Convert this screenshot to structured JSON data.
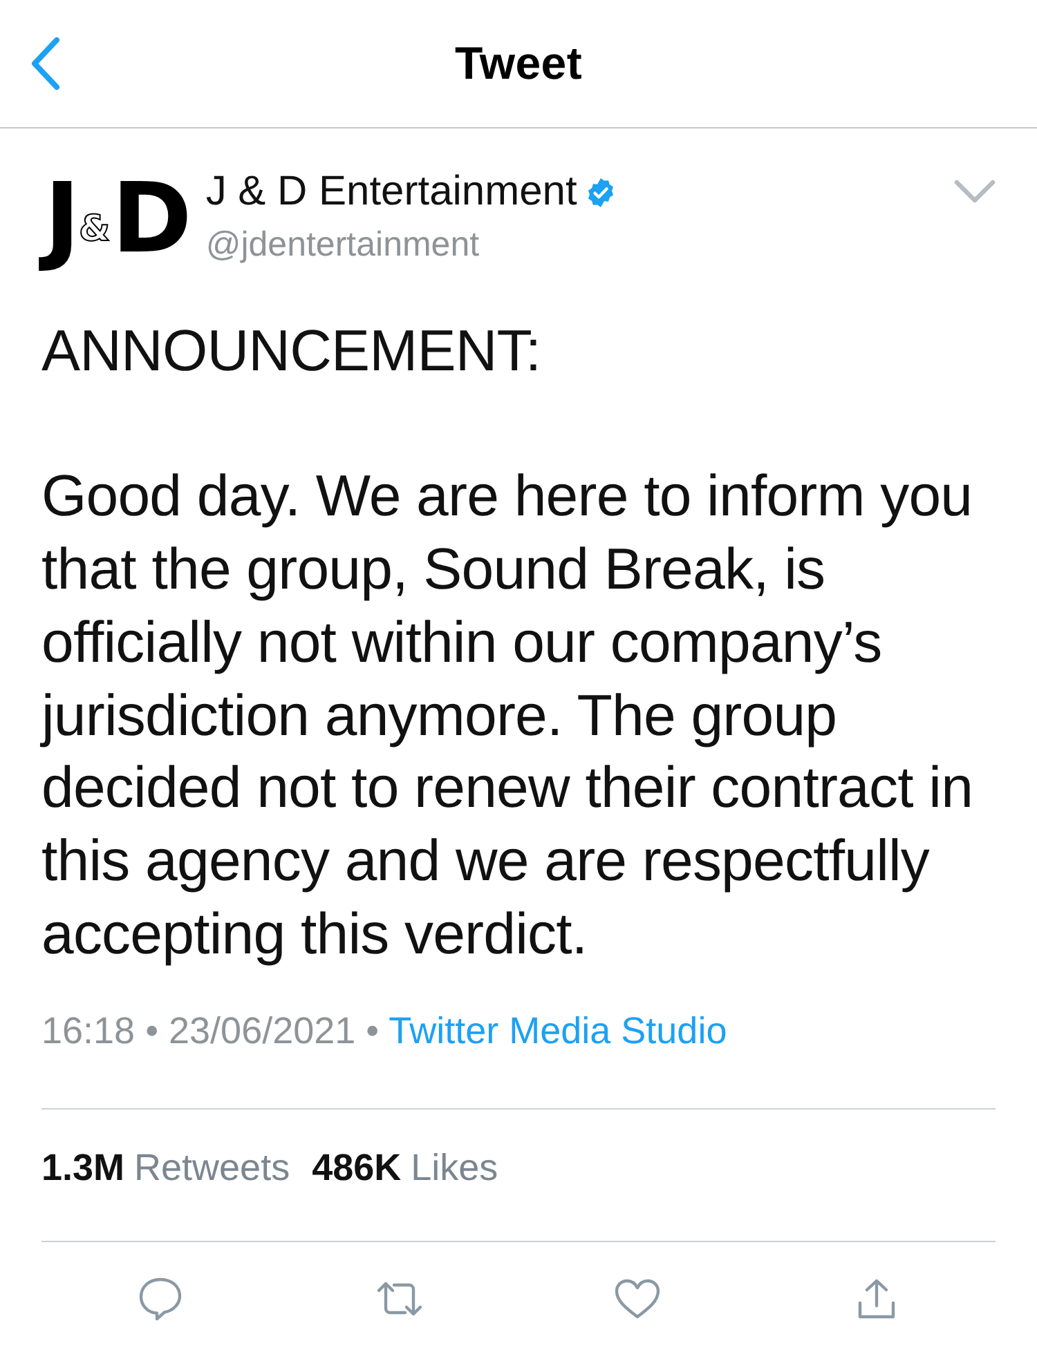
{
  "nav": {
    "title": "Tweet"
  },
  "tweet": {
    "author": {
      "avatar_letters": [
        "J",
        "&",
        "D"
      ],
      "name": "J & D Entertainment",
      "verified": true,
      "handle": "@jdentertainment"
    },
    "paragraphs": [
      "ANNOUNCEMENT:",
      "Good day. We are here to inform you that the group, Sound Break, is officially not within our company’s jurisdiction anymore. The group decided not to renew their contract in this agency and we are respectfully accepting this verdict."
    ],
    "timestamp": "16:18 • 23/06/2021 •",
    "source": "Twitter Media Studio",
    "stats": [
      {
        "count": "1.3M",
        "label": "Retweets"
      },
      {
        "count": "486K",
        "label": "Likes"
      }
    ],
    "actions": [
      {
        "kind": "reply"
      },
      {
        "kind": "retweet"
      },
      {
        "kind": "like"
      },
      {
        "kind": "share"
      }
    ]
  }
}
